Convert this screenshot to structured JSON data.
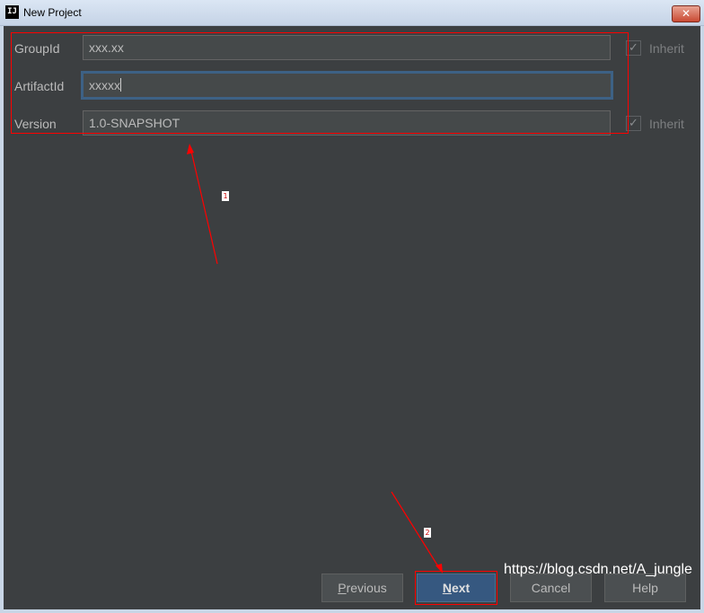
{
  "window": {
    "title": "New Project",
    "app_icon_text": "IJ",
    "close_glyph": "✕"
  },
  "form": {
    "group_id": {
      "label": "GroupId",
      "value": "xxx.xx",
      "inherit_label": "Inherit",
      "inherit_checked": true
    },
    "artifact_id": {
      "label": "ArtifactId",
      "value": "xxxxx"
    },
    "version": {
      "label": "Version",
      "value": "1.0-SNAPSHOT",
      "inherit_label": "Inherit",
      "inherit_checked": true
    }
  },
  "buttons": {
    "previous": {
      "mnemonic": "P",
      "rest": "revious"
    },
    "next": {
      "mnemonic": "N",
      "rest": "ext"
    },
    "cancel": {
      "label": "Cancel"
    },
    "help": {
      "label": "Help"
    }
  },
  "annotations": {
    "marker_1": "1",
    "marker_2": "2",
    "color": "#ff0000"
  },
  "watermark": "https://blog.csdn.net/A_jungle",
  "colors": {
    "background": "#3c3f41",
    "field": "#45494a",
    "focus_border": "#3d6185",
    "primary_button": "#365880"
  }
}
